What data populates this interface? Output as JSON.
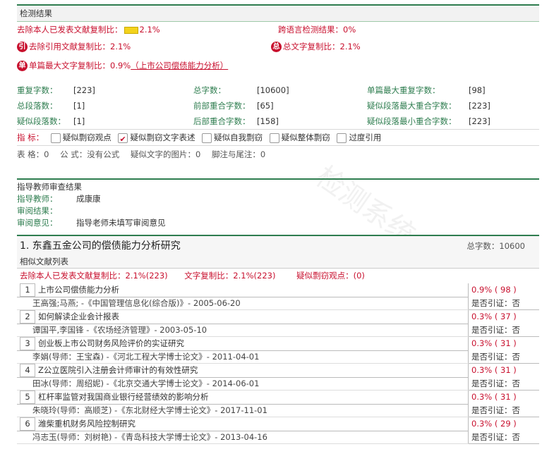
{
  "watermark": "检测系统",
  "detection": {
    "header": "检测结果",
    "exclude_own_label": "去除本人已发表文献复制比：",
    "exclude_own_value": "2.1%",
    "cross_lang_label": "跨语言检测结果：",
    "cross_lang_value": "0%",
    "exclude_cite_badge": "引",
    "exclude_cite_label": "去除引用文献复制比：",
    "exclude_cite_value": "2.1%",
    "total_badge": "总",
    "total_label": "总文字复制比：",
    "total_value": "2.1%",
    "single_badge": "单",
    "single_label": "单篇最大文字复制比：",
    "single_value": "0.9%",
    "single_link": "（上市公司偿债能力分析）",
    "stats": [
      [
        {
          "label": "重复字数：",
          "value": "[223]"
        },
        {
          "label": "总字数：",
          "value": "[10600]"
        },
        {
          "label": "单篇最大重复字数：",
          "value": "[98]"
        }
      ],
      [
        {
          "label": "总段落数：",
          "value": "[1]"
        },
        {
          "label": "前部重合字数：",
          "value": "[65]"
        },
        {
          "label": "疑似段落最大重合字数：",
          "value": "[223]"
        }
      ],
      [
        {
          "label": "疑似段落数：",
          "value": "[1]"
        },
        {
          "label": "后部重合字数：",
          "value": "[158]"
        },
        {
          "label": "疑似段落最小重合字数：",
          "value": "[223]"
        }
      ]
    ],
    "indicator_label": "指 标：",
    "indicators": [
      {
        "label": "疑似剽窃观点",
        "checked": false
      },
      {
        "label": "疑似剽窃文字表述",
        "checked": true
      },
      {
        "label": "疑似自我剽窃",
        "checked": false
      },
      {
        "label": "疑似整体剽窃",
        "checked": false
      },
      {
        "label": "过度引用",
        "checked": false
      }
    ],
    "meta": [
      "表 格：0",
      "公 式：没有公式",
      "疑似文字的图片：0",
      "脚注与尾注：0"
    ]
  },
  "review": {
    "header": "指导教师审查结果",
    "rows": [
      {
        "label": "指导教师：",
        "value": "成康康"
      },
      {
        "label": "审阅结果：",
        "value": ""
      },
      {
        "label": "审阅意见：",
        "value": "指导老师未填写审阅意见"
      }
    ]
  },
  "document": {
    "title": "1. 东鑫五金公司的偿债能力分析研究",
    "total_words": "总字数：10600",
    "sim_header": "相似文献列表",
    "summary_a": "去除本人已发表文献复制比：2.1%(223)",
    "summary_b": "文字复制比：2.1%(223)",
    "summary_c": "疑似剽窃观点：(0)",
    "items": [
      {
        "num": "1",
        "title": "上市公司偿债能力分析",
        "authors": "王高强;马燕; -《中国管理信息化(综合版)》- 2005-06-20",
        "pct": "0.9% ( 98 )",
        "cite": "是否引证：否"
      },
      {
        "num": "2",
        "title": "如何解读企业会计报表",
        "authors": "谭国平,李国锋 -《农场经济管理》- 2003-05-10",
        "pct": "0.3% ( 37 )",
        "cite": "是否引证：否"
      },
      {
        "num": "3",
        "title": "创业板上市公司财务风险评价的实证研究",
        "authors": "李娟(导师：王宝森) -《河北工程大学博士论文》- 2011-04-01",
        "pct": "0.3% ( 31 )",
        "cite": "是否引证：否"
      },
      {
        "num": "4",
        "title": "Z公立医院引入注册会计师审计的有效性研究",
        "authors": "田冰(导师：周绍妮) -《北京交通大学博士论文》- 2014-06-01",
        "pct": "0.3% ( 31 )",
        "cite": "是否引证：否"
      },
      {
        "num": "5",
        "title": "杠杆率监管对我国商业银行经营绩效的影响分析",
        "authors": "朱晓玲(导师：高顺芝) -《东北财经大学博士论文》- 2017-11-01",
        "pct": "0.3% ( 31 )",
        "cite": "是否引证：否"
      },
      {
        "num": "6",
        "title": "潍柴重机财务风险控制研究",
        "authors": "冯志玉(导师：刘树艳) -《青岛科技大学博士论文》- 2013-04-16",
        "pct": "0.3% ( 29 )",
        "cite": "是否引证：否"
      }
    ]
  }
}
